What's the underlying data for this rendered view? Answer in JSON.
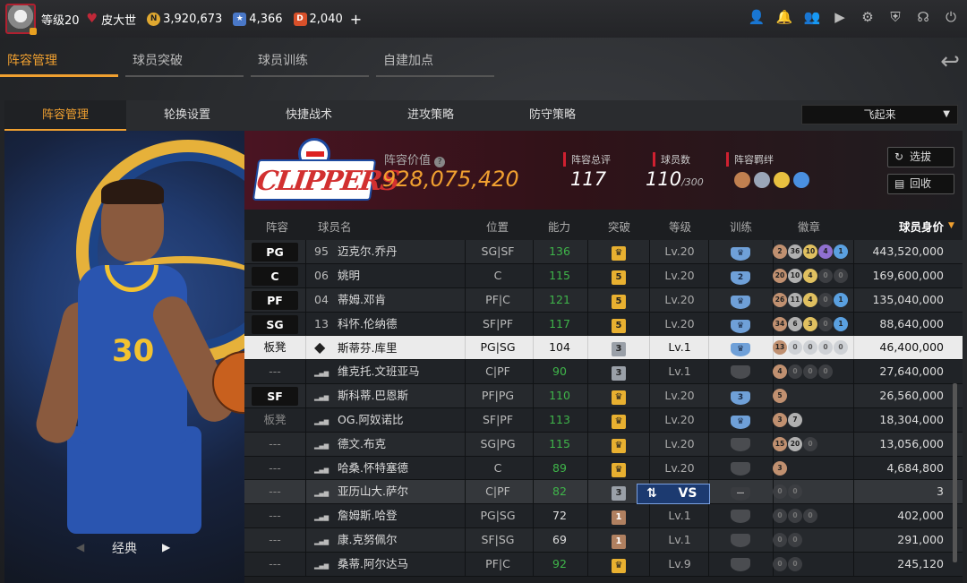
{
  "topbar": {
    "level_label": "等级20",
    "player_name": "皮大世",
    "gold": "3,920,673",
    "stars": "4,366",
    "diamonds": "2,040",
    "add": "+",
    "icons": [
      "user-icon",
      "bell-icon",
      "friends-icon",
      "video-icon",
      "gear-icon",
      "shield-icon",
      "headset-icon",
      "power-icon"
    ]
  },
  "main_tabs": [
    "阵容管理",
    "球员突破",
    "球员训练",
    "自建加点"
  ],
  "sub_tabs": [
    "阵容管理",
    "轮换设置",
    "快捷战术",
    "进攻策略",
    "防守策略"
  ],
  "dropdown": "飞起来",
  "player_card": {
    "label": "经典"
  },
  "team": {
    "logo_text": "CLIPPERS",
    "value_label": "阵容价值",
    "value": "928,075,420",
    "rating_label": "阵容总评",
    "rating": "117",
    "count_label": "球员数",
    "count": "110",
    "count_max": "/300",
    "bond_label": "阵容羁绊",
    "btn_select": "选拔",
    "btn_recycle": "回收"
  },
  "columns": [
    "阵容",
    "球员名",
    "位置",
    "能力",
    "突破",
    "等级",
    "训练",
    "徽章",
    "球员身价"
  ],
  "rows": [
    {
      "pos": "PG",
      "box": true,
      "num": "95",
      "name": "迈克尔.乔丹",
      "role": "SG|SF",
      "ability": "136",
      "green": true,
      "break": "crown",
      "level": "Lv.20",
      "train": "crown",
      "badges": [
        "2",
        "36",
        "10",
        "4",
        "1"
      ],
      "value": "443,520,000"
    },
    {
      "pos": "C",
      "box": true,
      "num": "06",
      "name": "姚明",
      "role": "C",
      "ability": "115",
      "green": true,
      "break": "5",
      "level": "Lv.20",
      "train": "2",
      "badges": [
        "20",
        "10",
        "4",
        "0",
        "0"
      ],
      "value": "169,600,000"
    },
    {
      "pos": "PF",
      "box": true,
      "num": "04",
      "name": "蒂姆.邓肯",
      "role": "PF|C",
      "ability": "121",
      "green": true,
      "break": "5",
      "level": "Lv.20",
      "train": "crown",
      "badges": [
        "26",
        "11",
        "4",
        "0",
        "1"
      ],
      "value": "135,040,000"
    },
    {
      "pos": "SG",
      "box": true,
      "num": "13",
      "name": "科怀.伦纳德",
      "role": "SF|PF",
      "ability": "117",
      "green": true,
      "break": "5",
      "level": "Lv.20",
      "train": "crown",
      "badges": [
        "34",
        "6",
        "3",
        "0",
        "1"
      ],
      "value": "88,640,000"
    },
    {
      "pos": "板凳",
      "box": false,
      "num": "",
      "name": "斯蒂芬.库里",
      "role": "PG|SG",
      "ability": "104",
      "green": false,
      "break": "3",
      "level": "Lv.1",
      "train": "crown",
      "badges": [
        "13",
        "0",
        "0",
        "0",
        "0"
      ],
      "value": "46,400,000",
      "selected": true
    },
    {
      "pos": "---",
      "box": false,
      "num": "",
      "name": "维克托.文班亚马",
      "role": "C|PF",
      "ability": "90",
      "green": true,
      "break": "3",
      "level": "Lv.1",
      "train": "none",
      "badges": [
        "4",
        "0",
        "0",
        "0"
      ],
      "value": "27,640,000"
    },
    {
      "pos": "SF",
      "box": true,
      "num": "",
      "name": "斯科蒂.巴恩斯",
      "role": "PF|PG",
      "ability": "110",
      "green": true,
      "break": "crown",
      "level": "Lv.20",
      "train": "3",
      "badges": [
        "5"
      ],
      "value": "26,560,000"
    },
    {
      "pos": "板凳",
      "box": false,
      "num": "",
      "name": "OG.阿奴诺比",
      "role": "SF|PF",
      "ability": "113",
      "green": true,
      "break": "crown",
      "level": "Lv.20",
      "train": "crown",
      "badges": [
        "3",
        "7"
      ],
      "value": "18,304,000"
    },
    {
      "pos": "---",
      "box": false,
      "num": "",
      "name": "德文.布克",
      "role": "SG|PG",
      "ability": "115",
      "green": true,
      "break": "crown",
      "level": "Lv.20",
      "train": "none",
      "badges": [
        "15",
        "20",
        "0"
      ],
      "value": "13,056,000"
    },
    {
      "pos": "---",
      "box": false,
      "num": "",
      "name": "哈桑.怀特塞德",
      "role": "C",
      "ability": "89",
      "green": true,
      "break": "crown",
      "level": "Lv.20",
      "train": "none",
      "badges": [
        "3"
      ],
      "value": "4,684,800"
    },
    {
      "pos": "---",
      "box": false,
      "num": "",
      "name": "亚历山大.萨尔",
      "role": "C|PF",
      "ability": "82",
      "green": true,
      "break": "3",
      "level": "Lv.20",
      "train": "dash",
      "badges": [
        "0",
        "0"
      ],
      "value": "3",
      "dim": true
    },
    {
      "pos": "---",
      "box": false,
      "num": "",
      "name": "詹姆斯.哈登",
      "role": "PG|SG",
      "ability": "72",
      "green": false,
      "break": "1",
      "level": "Lv.1",
      "train": "none",
      "badges": [
        "0",
        "0",
        "0"
      ],
      "value": "402,000"
    },
    {
      "pos": "---",
      "box": false,
      "num": "",
      "name": "康.克努佩尔",
      "role": "SF|SG",
      "ability": "69",
      "green": false,
      "break": "1",
      "level": "Lv.1",
      "train": "none",
      "badges": [
        "0",
        "0"
      ],
      "value": "291,000"
    },
    {
      "pos": "---",
      "box": false,
      "num": "",
      "name": "桑蒂.阿尔达马",
      "role": "PF|C",
      "ability": "92",
      "green": true,
      "break": "crown",
      "level": "Lv.9",
      "train": "none",
      "badges": [
        "0",
        "0"
      ],
      "value": "245,120"
    }
  ],
  "vs_button": {
    "swap": "⇅",
    "vs": "VS"
  },
  "colors": {
    "accent": "#f0a030",
    "green": "#3fb54a",
    "gold": "#e8b030"
  }
}
